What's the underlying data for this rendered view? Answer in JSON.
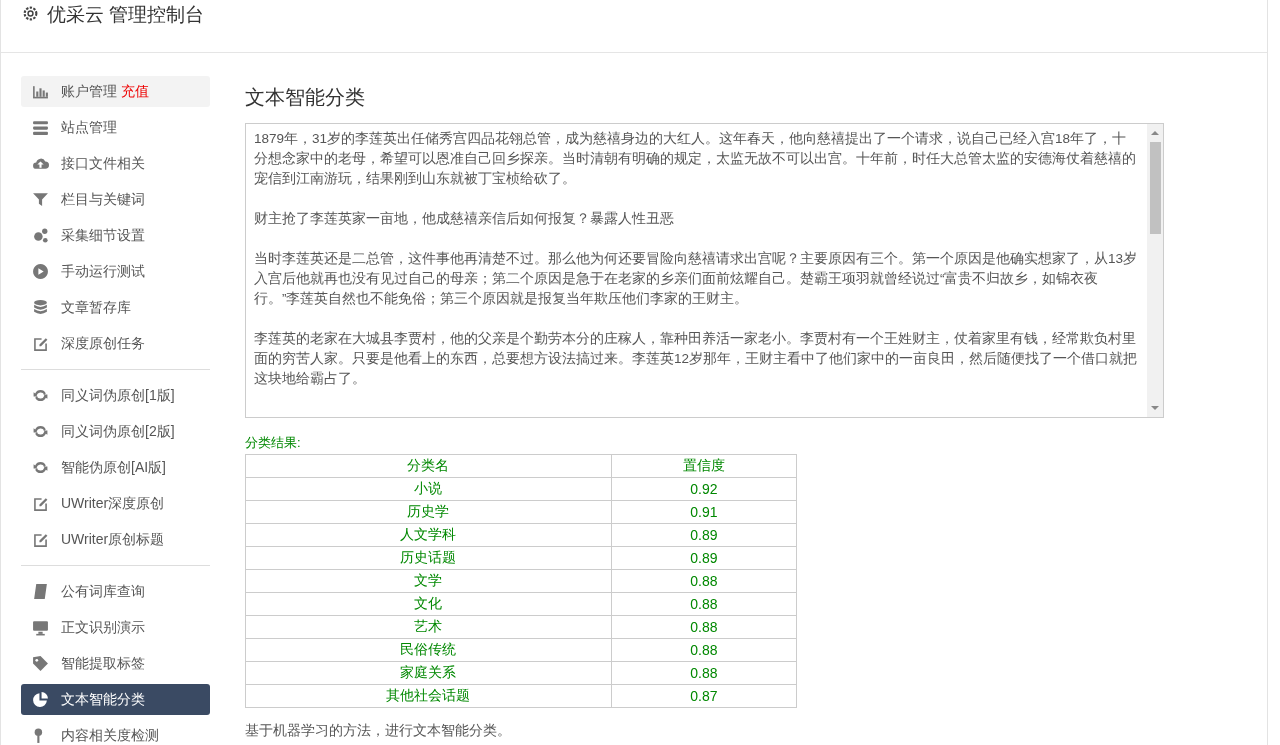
{
  "header": {
    "title": "优采云 管理控制台"
  },
  "sidebar": {
    "groups": [
      {
        "items": [
          {
            "label": "账户管理",
            "badge": "充值",
            "selected": false,
            "highlighted": true
          },
          {
            "label": "站点管理",
            "selected": false,
            "highlighted": false
          },
          {
            "label": "接口文件相关",
            "selected": false,
            "highlighted": false
          },
          {
            "label": "栏目与关键词",
            "selected": false,
            "highlighted": false
          },
          {
            "label": "采集细节设置",
            "selected": false,
            "highlighted": false
          },
          {
            "label": "手动运行测试",
            "selected": false,
            "highlighted": false
          },
          {
            "label": "文章暂存库",
            "selected": false,
            "highlighted": false
          },
          {
            "label": "深度原创任务",
            "selected": false,
            "highlighted": false
          }
        ]
      },
      {
        "items": [
          {
            "label": "同义词伪原创[1版]",
            "selected": false,
            "highlighted": false
          },
          {
            "label": "同义词伪原创[2版]",
            "selected": false,
            "highlighted": false
          },
          {
            "label": "智能伪原创[AI版]",
            "selected": false,
            "highlighted": false
          },
          {
            "label": "UWriter深度原创",
            "selected": false,
            "highlighted": false
          },
          {
            "label": "UWriter原创标题",
            "selected": false,
            "highlighted": false
          }
        ]
      },
      {
        "items": [
          {
            "label": "公有词库查询",
            "selected": false,
            "highlighted": false
          },
          {
            "label": "正文识别演示",
            "selected": false,
            "highlighted": false
          },
          {
            "label": "智能提取标签",
            "selected": false,
            "highlighted": false
          },
          {
            "label": "文本智能分类",
            "selected": true,
            "highlighted": false
          },
          {
            "label": "内容相关度检测",
            "selected": false,
            "highlighted": false
          }
        ]
      }
    ]
  },
  "main": {
    "title": "文本智能分类",
    "input_text": [
      "1879年，31岁的李莲英出任储秀宫四品花翎总管，成为慈禧身边的大红人。这年春天，他向慈禧提出了一个请求，说自己已经入宫18年了，十分想念家中的老母，希望可以恩准自己回乡探亲。当时清朝有明确的规定，太监无故不可以出宫。十年前，时任大总管太监的安德海仗着慈禧的宠信到江南游玩，结果刚到山东就被丁宝桢给砍了。",
      "财主抢了李莲英家一亩地，他成慈禧亲信后如何报复？暴露人性丑恶",
      "当时李莲英还是二总管，这件事他再清楚不过。那么他为何还要冒险向慈禧请求出宫呢？主要原因有三个。第一个原因是他确实想家了，从13岁入宫后他就再也没有见过自己的母亲；第二个原因是急于在老家的乡亲们面前炫耀自己。楚霸王项羽就曾经说过“富贵不归故乡，如锦衣夜行。”李莲英自然也不能免俗；第三个原因就是报复当年欺压他们李家的王财主。",
      "李莲英的老家在大城县李贾村，他的父亲是个勤劳本分的庄稼人，靠种田养活一家老小。李贾村有一个王姓财主，仗着家里有钱，经常欺负村里面的穷苦人家。只要是他看上的东西，总要想方设法搞过来。李莲英12岁那年，王财主看中了他们家中的一亩良田，然后随便找了一个借口就把这块地给霸占了。"
    ],
    "result_label": "分类结果:",
    "table": {
      "columns": [
        "分类名",
        "置信度"
      ],
      "rows": [
        [
          "小说",
          "0.92"
        ],
        [
          "历史学",
          "0.91"
        ],
        [
          "人文学科",
          "0.89"
        ],
        [
          "历史话题",
          "0.89"
        ],
        [
          "文学",
          "0.88"
        ],
        [
          "文化",
          "0.88"
        ],
        [
          "艺术",
          "0.88"
        ],
        [
          "民俗传统",
          "0.88"
        ],
        [
          "家庭关系",
          "0.88"
        ],
        [
          "其他社会话题",
          "0.87"
        ]
      ]
    },
    "note": "基于机器学习的方法，进行文本智能分类。"
  }
}
